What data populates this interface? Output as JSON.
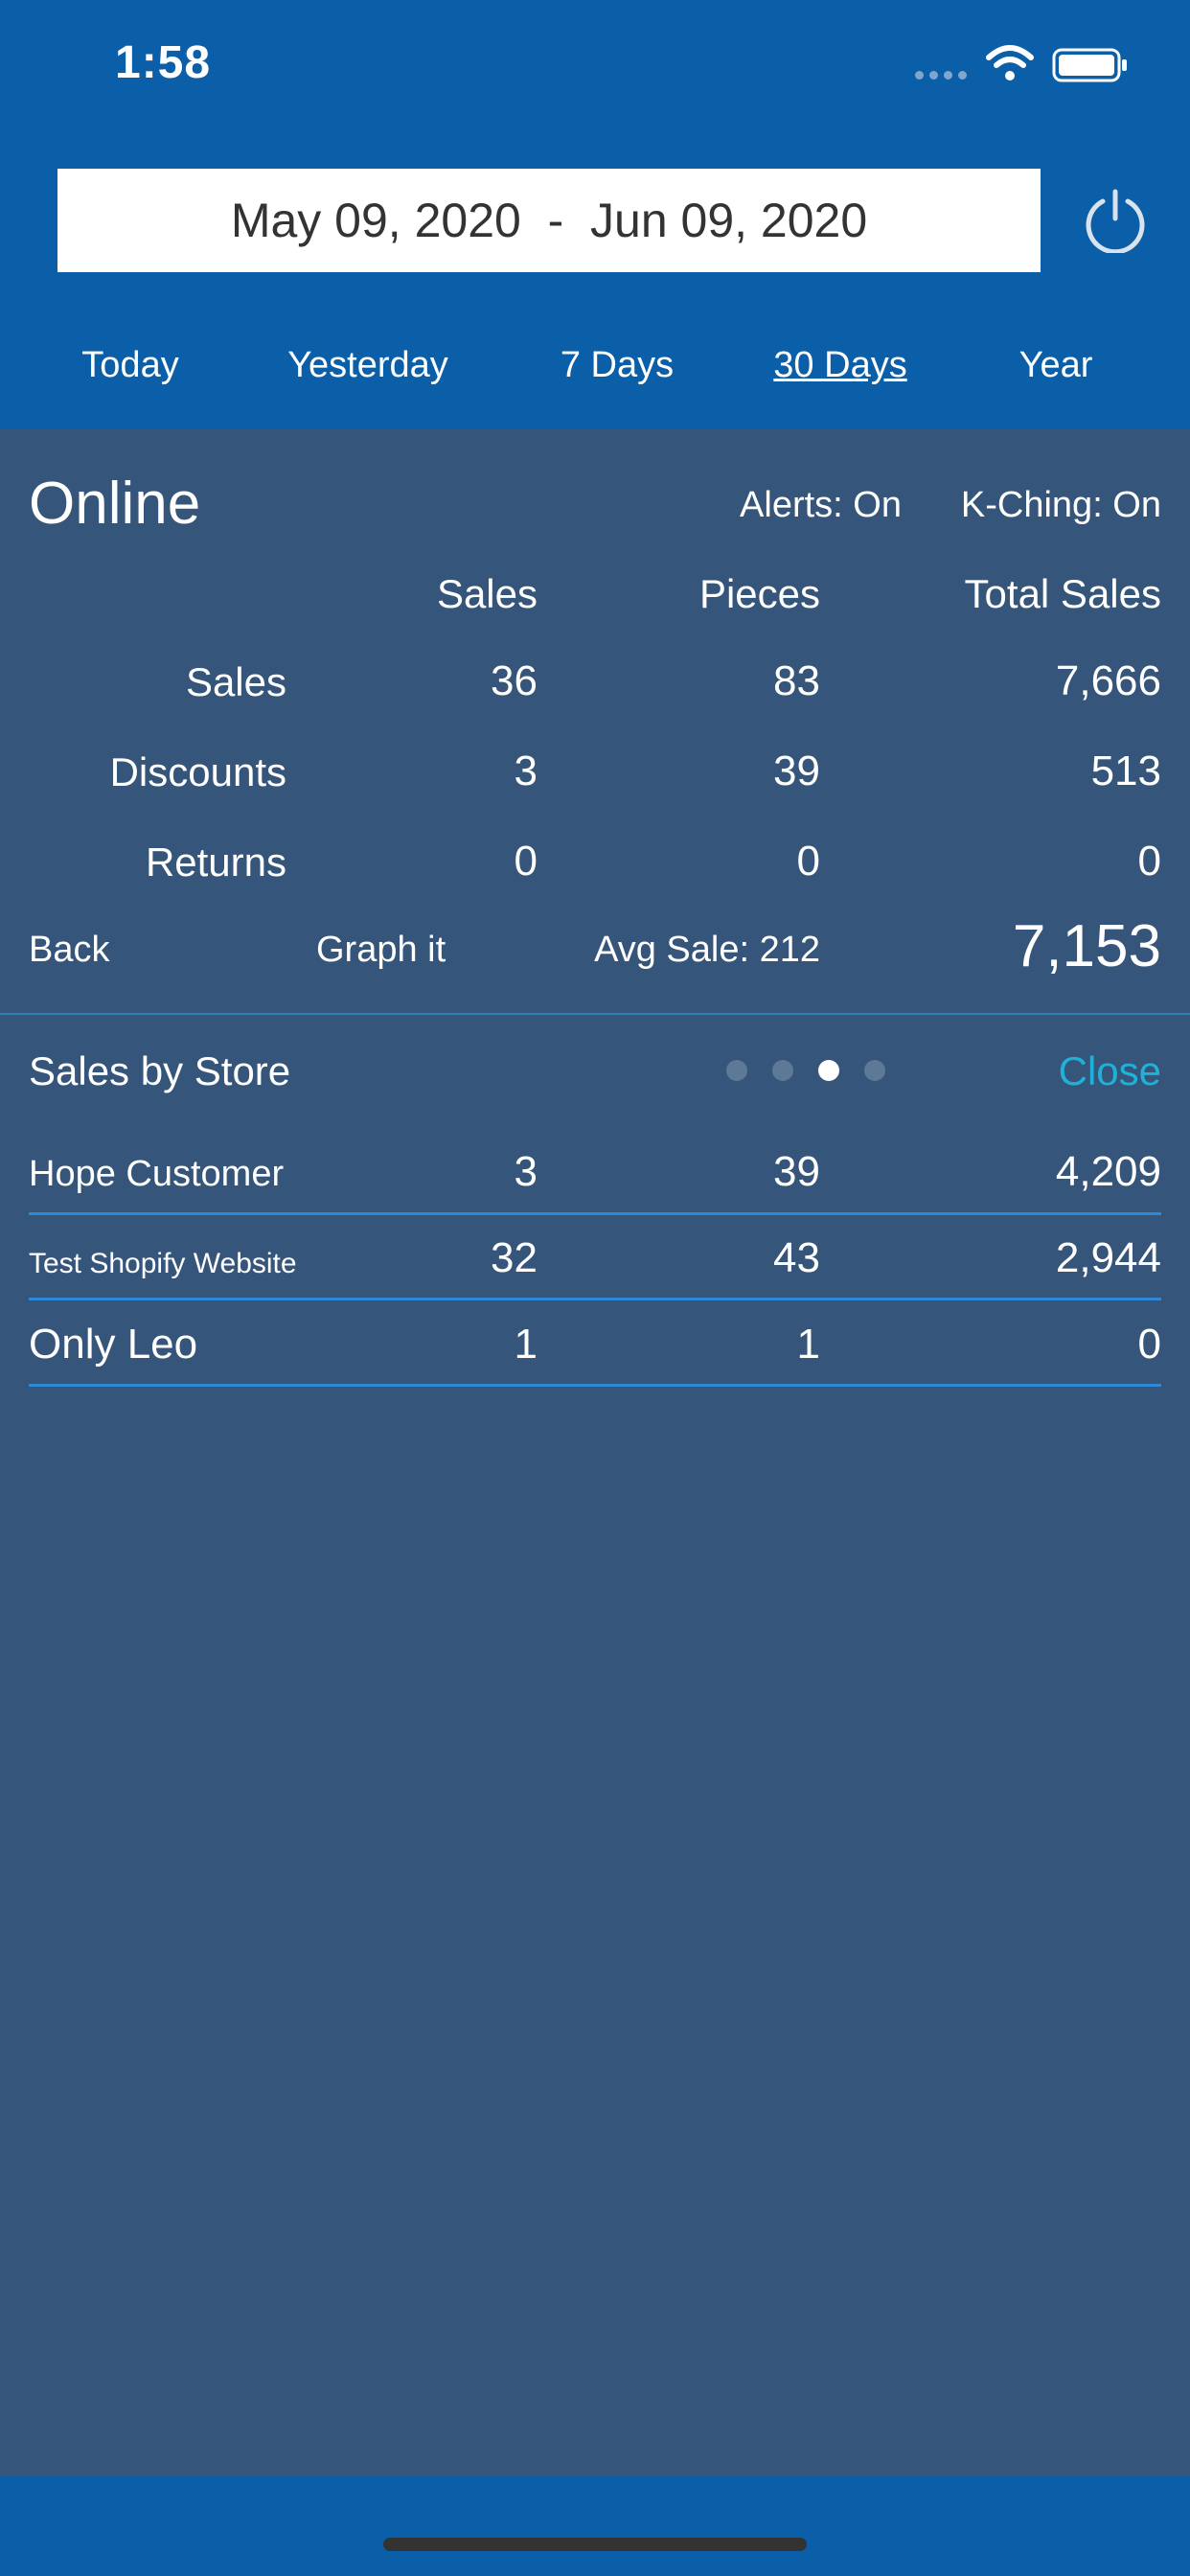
{
  "status_bar": {
    "time": "1:58",
    "wifi_icon": "wifi-icon",
    "battery_icon": "battery-icon"
  },
  "header": {
    "date_range": "May 09, 2020  -  Jun 09, 2020",
    "power_icon": "power-icon",
    "range_tabs": [
      "Today",
      "Yesterday",
      "7 Days",
      "30 Days",
      "Year"
    ],
    "active_tab": "30 Days"
  },
  "summary": {
    "title": "Online",
    "alerts": "Alerts: On",
    "kching": "K-Ching: On",
    "columns": [
      "Sales",
      "Pieces",
      "Total Sales"
    ],
    "rows": [
      {
        "label": "Sales",
        "sales": "36",
        "pieces": "83",
        "total": "7,666"
      },
      {
        "label": "Discounts",
        "sales": "3",
        "pieces": "39",
        "total": "513"
      },
      {
        "label": "Returns",
        "sales": "0",
        "pieces": "0",
        "total": "0"
      }
    ],
    "back": "Back",
    "graph": "Graph it",
    "avg_sale": "Avg Sale: 212",
    "grand_total": "7,153"
  },
  "stores": {
    "title": "Sales by Store",
    "page_count": 4,
    "active_page": 3,
    "close": "Close",
    "rows": [
      {
        "name": "Hope Customer",
        "sales": "3",
        "pieces": "39",
        "total": "4,209"
      },
      {
        "name": "Test Shopify Website",
        "sales": "32",
        "pieces": "43",
        "total": "2,944"
      },
      {
        "name": "Only Leo",
        "sales": "1",
        "pieces": "1",
        "total": "0"
      }
    ]
  },
  "colors": {
    "header_bg": "#0B5EA8",
    "body_bg": "#36557A",
    "accent": "#1FB2D8",
    "row_line": "#2E8AD8"
  }
}
